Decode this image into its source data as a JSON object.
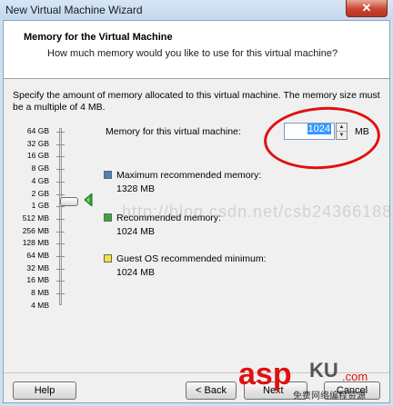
{
  "window": {
    "title": "New Virtual Machine Wizard",
    "close_glyph": "✕"
  },
  "header": {
    "title": "Memory for the Virtual Machine",
    "subtitle": "How much memory would you like to use for this virtual machine?"
  },
  "description": "Specify the amount of memory allocated to this virtual machine. The memory size must be a multiple of 4 MB.",
  "scale_labels": [
    "64 GB",
    "32 GB",
    "16 GB",
    "8 GB",
    "4 GB",
    "2 GB",
    "1 GB",
    "512 MB",
    "256 MB",
    "128 MB",
    "64 MB",
    "32 MB",
    "16 MB",
    "8 MB",
    "4 MB"
  ],
  "memory": {
    "label": "Memory for this virtual machine:",
    "value": "1024",
    "unit": "MB"
  },
  "recommendations": [
    {
      "label": "Maximum recommended memory:",
      "value": "1328 MB",
      "color": "#4a7fc0"
    },
    {
      "label": "Recommended memory:",
      "value": "1024 MB",
      "color": "#3aa63a"
    },
    {
      "label": "Guest OS recommended minimum:",
      "value": "1024 MB",
      "color": "#f2e23a"
    }
  ],
  "watermark": "http://blog.csdn.net/csb24366188",
  "buttons": {
    "help": "Help",
    "back": "< Back",
    "next": "Next",
    "cancel": "Cancel"
  },
  "logo": {
    "text": "asp",
    "suffix": "KU",
    "domain": ".com",
    "tagline": "免费网络编程资源"
  },
  "colors": {
    "accent_red": "#e01010",
    "slider_marker": "#3aa63a"
  }
}
